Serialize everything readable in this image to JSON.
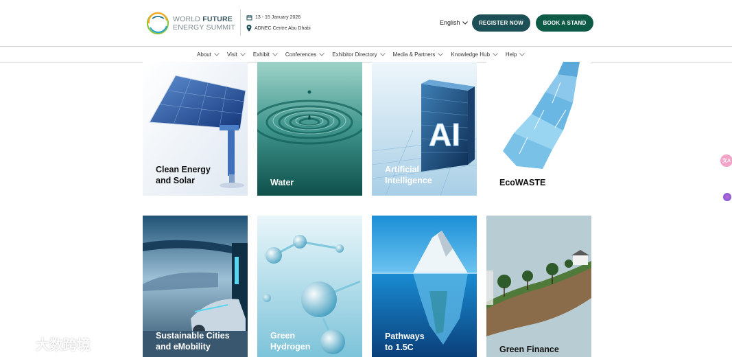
{
  "header": {
    "logo_line1": "WORLD",
    "logo_line1_bold": "FUTURE",
    "logo_line2": "ENERGY SUMMIT",
    "event_date": "13 - 15 January 2026",
    "event_venue": "ADNEC Centre Abu Dhabi",
    "language": "English",
    "register_label": "REGISTER NOW",
    "book_label": "BOOK A STAND"
  },
  "nav": {
    "items": [
      {
        "label": "About"
      },
      {
        "label": "Visit"
      },
      {
        "label": "Exhibit"
      },
      {
        "label": "Conferences"
      },
      {
        "label": "Exhibitor Directory"
      },
      {
        "label": "Media & Partners"
      },
      {
        "label": "Knowledge Hub"
      },
      {
        "label": "Help"
      }
    ]
  },
  "tiles": [
    {
      "line1": "Clean Energy",
      "line2": "and Solar"
    },
    {
      "line1": "Water",
      "line2": ""
    },
    {
      "line1": "Artificial",
      "line2": "Intelligence",
      "art_text": "AI"
    },
    {
      "line1": "EcoWASTE",
      "line2": ""
    },
    {
      "line1": "Sustainable Cities",
      "line2": "and eMobility"
    },
    {
      "line1": "Green",
      "line2": "Hydrogen"
    },
    {
      "line1": "Pathways",
      "line2": "to 1.5C"
    },
    {
      "line1": "Green Finance",
      "line2": ""
    }
  ],
  "watermark": "大数跨境",
  "side_icons": {
    "translate_glyph": "文A"
  },
  "colors": {
    "register_btn": "#1d4f57",
    "book_btn": "#0d5a46",
    "logo_text": "#3a5660"
  }
}
